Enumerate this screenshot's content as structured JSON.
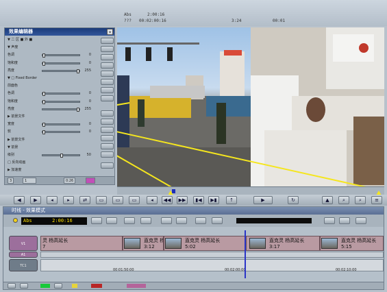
{
  "topbar": {
    "abs": "Abs",
    "abs_time": "2:00:16",
    "row2a": "???",
    "row2b": "00:02:00:16",
    "mid": "3:24",
    "right": "00:01"
  },
  "effect_editor": {
    "title": "效果编辑器",
    "rows": [
      {
        "label": "▼ 二 区 ■ 外 ■"
      },
      {
        "label": "▼ 声度"
      },
      {
        "label": "  色调",
        "value": "0"
      },
      {
        "label": "  饱和度",
        "value": "0"
      },
      {
        "label": "  亮度",
        "value": "255"
      },
      {
        "label": "▼ □ Fixed Border"
      },
      {
        "label": "    前面色"
      },
      {
        "label": "  色调",
        "value": "0"
      },
      {
        "label": "  饱和度",
        "value": "0"
      },
      {
        "label": "  亮度",
        "value": "255"
      },
      {
        "label": "▶ 前景文件"
      },
      {
        "label": "  宽度",
        "value": "0"
      },
      {
        "label": "  软",
        "value": "0"
      },
      {
        "label": "▶ 前景文件"
      },
      {
        "label": "▼ 前景"
      },
      {
        "label": "  级别",
        "value": "50"
      },
      {
        "label": "  □ 反向动画"
      },
      {
        "label": "▶ 加速度"
      }
    ],
    "footer": {
      "field1": "3",
      "field2": "1",
      "time": "0:26"
    }
  },
  "timeline": {
    "title": "时线 - 效果模式",
    "timecode_label": "Abs",
    "timecode": "2:00:16",
    "tracks": [
      "V1",
      "A1",
      "TC1"
    ],
    "clips": [
      {
        "text1": "灵  杨高延长",
        "text2": "7"
      },
      {
        "text1": "直克灵  杨高延长",
        "text2": "3:12"
      },
      {
        "text1": "直克灵  杨高延长",
        "text2": "5:02"
      },
      {
        "text1": "直克灵  杨高延长",
        "text2": "3:17"
      },
      {
        "text1": "直克灵  杨高延长",
        "text2": "5:15"
      }
    ],
    "ruler": [
      "00:01:50:00",
      "00:02:00:00",
      "00:02:10:00"
    ]
  }
}
